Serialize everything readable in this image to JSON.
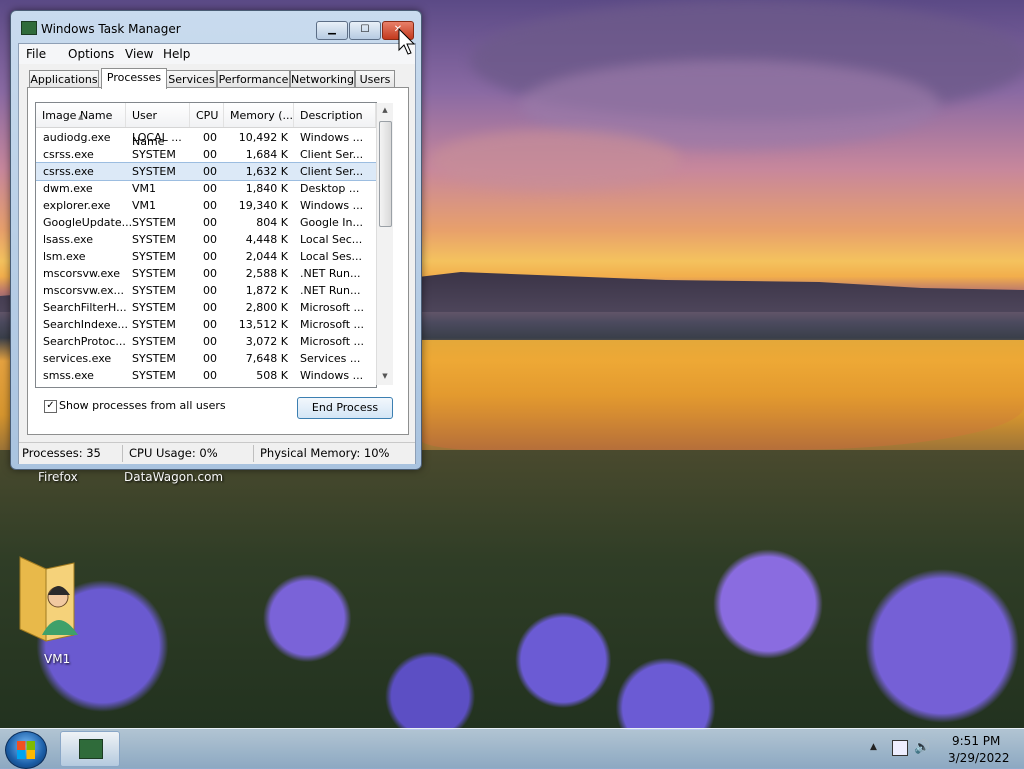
{
  "window": {
    "title": "Windows Task Manager",
    "min_glyph": "▁",
    "max_glyph": "☐",
    "close_glyph": "✕"
  },
  "menu": [
    "File",
    "Options",
    "View",
    "Help"
  ],
  "tabs": [
    {
      "label": "Applications",
      "active": false
    },
    {
      "label": "Processes",
      "active": true
    },
    {
      "label": "Services",
      "active": false
    },
    {
      "label": "Performance",
      "active": false
    },
    {
      "label": "Networking",
      "active": false
    },
    {
      "label": "Users",
      "active": false
    }
  ],
  "columns": [
    "Image Name",
    "User Name",
    "CPU",
    "Memory (...",
    "Description"
  ],
  "processes": [
    {
      "name": "audiodg.exe",
      "user": "LOCAL ...",
      "cpu": "00",
      "mem": "10,492 K",
      "desc": "Windows ..."
    },
    {
      "name": "csrss.exe",
      "user": "SYSTEM",
      "cpu": "00",
      "mem": "1,684 K",
      "desc": "Client Ser..."
    },
    {
      "name": "csrss.exe",
      "user": "SYSTEM",
      "cpu": "00",
      "mem": "1,632 K",
      "desc": "Client Ser...",
      "selected": true
    },
    {
      "name": "dwm.exe",
      "user": "VM1",
      "cpu": "00",
      "mem": "1,840 K",
      "desc": "Desktop ..."
    },
    {
      "name": "explorer.exe",
      "user": "VM1",
      "cpu": "00",
      "mem": "19,340 K",
      "desc": "Windows ..."
    },
    {
      "name": "GoogleUpdate...",
      "user": "SYSTEM",
      "cpu": "00",
      "mem": "804 K",
      "desc": "Google In..."
    },
    {
      "name": "lsass.exe",
      "user": "SYSTEM",
      "cpu": "00",
      "mem": "4,448 K",
      "desc": "Local Sec..."
    },
    {
      "name": "lsm.exe",
      "user": "SYSTEM",
      "cpu": "00",
      "mem": "2,044 K",
      "desc": "Local Ses..."
    },
    {
      "name": "mscorsvw.exe",
      "user": "SYSTEM",
      "cpu": "00",
      "mem": "2,588 K",
      "desc": ".NET Run..."
    },
    {
      "name": "mscorsvw.ex...",
      "user": "SYSTEM",
      "cpu": "00",
      "mem": "1,872 K",
      "desc": ".NET Run..."
    },
    {
      "name": "SearchFilterH...",
      "user": "SYSTEM",
      "cpu": "00",
      "mem": "2,800 K",
      "desc": "Microsoft ..."
    },
    {
      "name": "SearchIndexe...",
      "user": "SYSTEM",
      "cpu": "00",
      "mem": "13,512 K",
      "desc": "Microsoft ..."
    },
    {
      "name": "SearchProtoc...",
      "user": "SYSTEM",
      "cpu": "00",
      "mem": "3,072 K",
      "desc": "Microsoft ..."
    },
    {
      "name": "services.exe",
      "user": "SYSTEM",
      "cpu": "00",
      "mem": "7,648 K",
      "desc": "Services ..."
    },
    {
      "name": "smss.exe",
      "user": "SYSTEM",
      "cpu": "00",
      "mem": "508 K",
      "desc": "Windows ..."
    }
  ],
  "show_all_label": "Show processes from all users",
  "show_all_checked": true,
  "end_process_label": "End Process",
  "status": {
    "processes": "Processes: 35",
    "cpu": "CPU Usage: 0%",
    "memory": "Physical Memory: 10%"
  },
  "desktop": {
    "icon_firefox": "Firefox",
    "icon_datawagon": "DataWagon.com",
    "icon_vm1": "VM1"
  },
  "tray": {
    "time": "9:51 PM",
    "date": "3/29/2022"
  },
  "icons": {
    "check": "✓",
    "sort_up": "▲",
    "scroll_up": "▲",
    "scroll_down": "▼",
    "tray_arrow": "▲",
    "volume": "🔊"
  }
}
